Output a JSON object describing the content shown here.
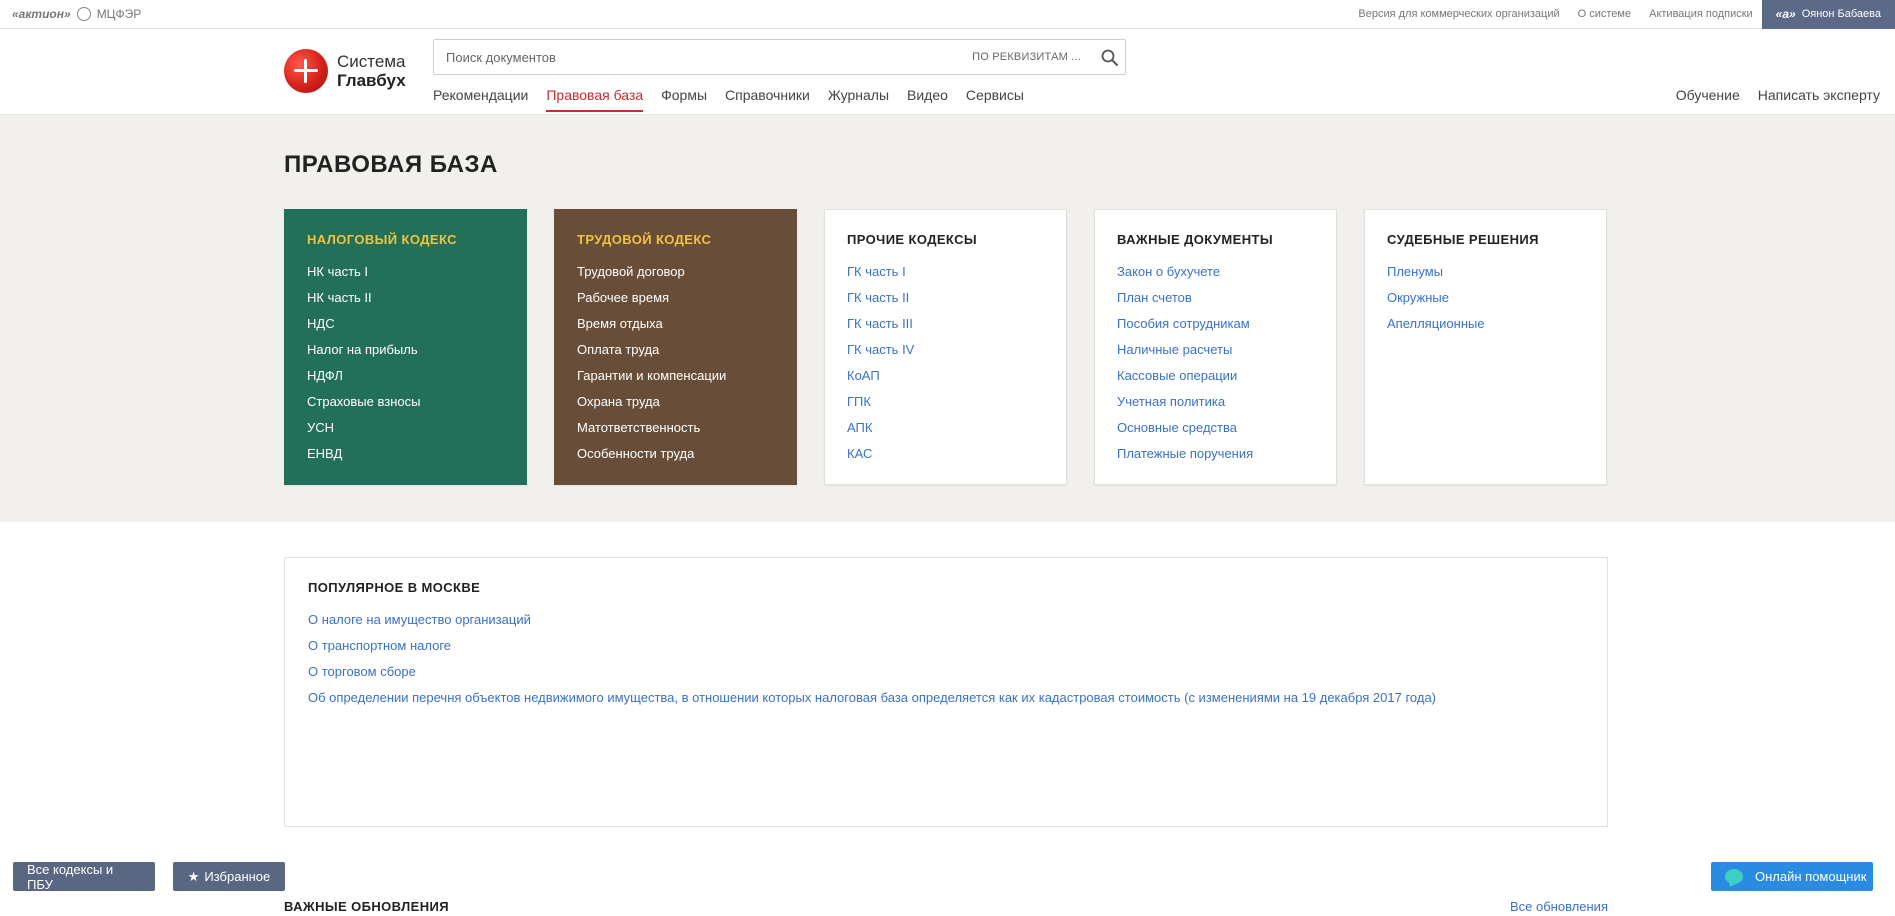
{
  "topbar": {
    "brand_aktion": "«актион»",
    "brand_mcfer": "МЦФЭР",
    "links": [
      "Версия для коммерческих организаций",
      "О системе",
      "Активация подписки"
    ],
    "user_prefix": "«а»",
    "user_name": "Оянон Бабаева"
  },
  "header": {
    "logo_line1": "Система",
    "logo_line2": "Главбух",
    "search_placeholder": "Поиск документов",
    "search_requisites": "ПО РЕКВИЗИТАМ ...",
    "nav": [
      "Рекомендации",
      "Правовая база",
      "Формы",
      "Справочники",
      "Журналы",
      "Видео",
      "Сервисы"
    ],
    "nav_active": "Правовая база",
    "right_nav": [
      "Обучение",
      "Написать эксперту"
    ]
  },
  "legal_base": {
    "title": "ПРАВОВАЯ БАЗА",
    "cards": [
      {
        "title": "НАЛОГОВЫЙ КОДЕКС",
        "items": [
          "НК часть I",
          "НК часть II",
          "НДС",
          "Налог на прибыль",
          "НДФЛ",
          "Страховые взносы",
          "УСН",
          "ЕНВД"
        ]
      },
      {
        "title": "ТРУДОВОЙ КОДЕКС",
        "items": [
          "Трудовой договор",
          "Рабочее время",
          "Время отдыха",
          "Оплата труда",
          "Гарантии и компенсации",
          "Охрана труда",
          "Матответственность",
          "Особенности труда"
        ]
      },
      {
        "title": "ПРОЧИЕ КОДЕКСЫ",
        "items": [
          "ГК часть I",
          "ГК часть II",
          "ГК часть III",
          "ГК часть IV",
          "КоАП",
          "ГПК",
          "АПК",
          "КАС"
        ]
      },
      {
        "title": "ВАЖНЫЕ ДОКУМЕНТЫ",
        "items": [
          "Закон о бухучете",
          "План счетов",
          "Пособия сотрудникам",
          "Наличные расчеты",
          "Кассовые операции",
          "Учетная политика",
          "Основные средства",
          "Платежные поручения"
        ]
      },
      {
        "title": "СУДЕБНЫЕ РЕШЕНИЯ",
        "items": [
          "Пленумы",
          "Окружные",
          "Апелляционные"
        ]
      }
    ]
  },
  "popular": {
    "title": "ПОПУЛЯРНОЕ В МОСКВЕ",
    "items": [
      "О налоге на имущество организаций",
      "О транспортном налоге",
      "О торговом сборе",
      "Об определении перечня объектов недвижимого имущества, в отношении которых налоговая база определяется как их кадастровая стоимость (с изменениями на 19 декабря 2017 года)"
    ]
  },
  "bottom": {
    "updates_title": "ВАЖНЫЕ ОБНОВЛЕНИЯ",
    "updates_all": "Все обновления",
    "codes_button": "Все кодексы и ПБУ",
    "favorites_button": "Избранное",
    "favorites_icon": "★",
    "help_button": "Онлайн помощник"
  },
  "colors": {
    "accent_red": "#c62d2d",
    "link_blue": "#3a72c3",
    "card_green": "#23705a",
    "card_brown": "#684e39",
    "card_title_yellow": "#f0c43a",
    "button_slate": "#5a6783",
    "help_blue": "#2a8be2"
  }
}
